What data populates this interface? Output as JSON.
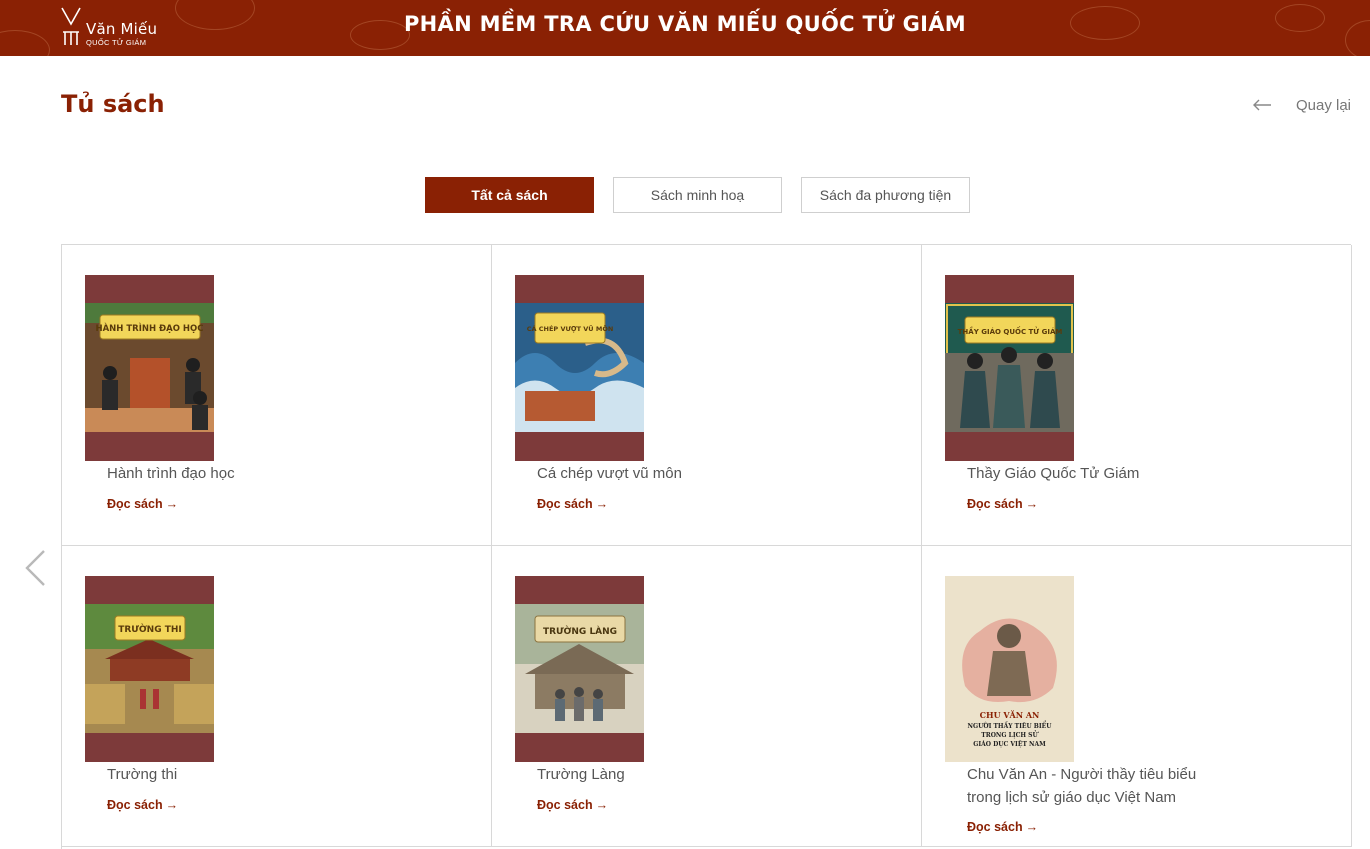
{
  "header": {
    "logo_name": "Văn Miếu",
    "logo_sub": "QUỐC TỬ GIÁM",
    "app_title": "PHẦN MỀM TRA CỨU VĂN MIẾU QUỐC TỬ GIÁM",
    "background_color": "#8a2104"
  },
  "page": {
    "title": "Tủ sách",
    "back_label": "Quay lại",
    "back_icon": "arrow-left-icon"
  },
  "tabs": [
    {
      "label": "Tất cả sách",
      "active": true
    },
    {
      "label": "Sách minh hoạ",
      "active": false
    },
    {
      "label": "Sách đa phương tiện",
      "active": false
    }
  ],
  "books": [
    {
      "title": "Hành trình đạo học",
      "read_label": "Đọc sách"
    },
    {
      "title": "Cá chép vượt vũ môn",
      "read_label": "Đọc sách"
    },
    {
      "title": "Thầy Giáo Quốc Tử Giám",
      "read_label": "Đọc sách"
    },
    {
      "title": "Trường thi",
      "read_label": "Đọc sách"
    },
    {
      "title": "Trường Làng",
      "read_label": "Đọc sách"
    },
    {
      "title": "Chu Văn An - Người thầy tiêu biểu trong lịch sử giáo dục Việt Nam",
      "read_label": "Đọc sách"
    }
  ],
  "covers": [
    {
      "banner": "HÀNH TRÌNH ĐẠO HỌC"
    },
    {
      "banner": "CÁ CHÉP VƯỢT VŨ MÔN"
    },
    {
      "banner": "THẦY GIÁO QUỐC TỬ GIÁM"
    },
    {
      "banner": "TRƯỜNG THI"
    },
    {
      "banner": "TRƯỜNG LÀNG"
    },
    {
      "line1": "CHU VĂN AN",
      "line2": "NGƯỜI THẦY TIÊU BIỂU",
      "line3": "TRONG LỊCH SỬ",
      "line4": "GIÁO DỤC VIỆT NAM"
    }
  ],
  "nav": {
    "prev_icon": "chevron-left-icon"
  },
  "colors": {
    "accent": "#8a2104",
    "cover_frame": "#7d3a3a",
    "border": "#d8d8d8"
  }
}
